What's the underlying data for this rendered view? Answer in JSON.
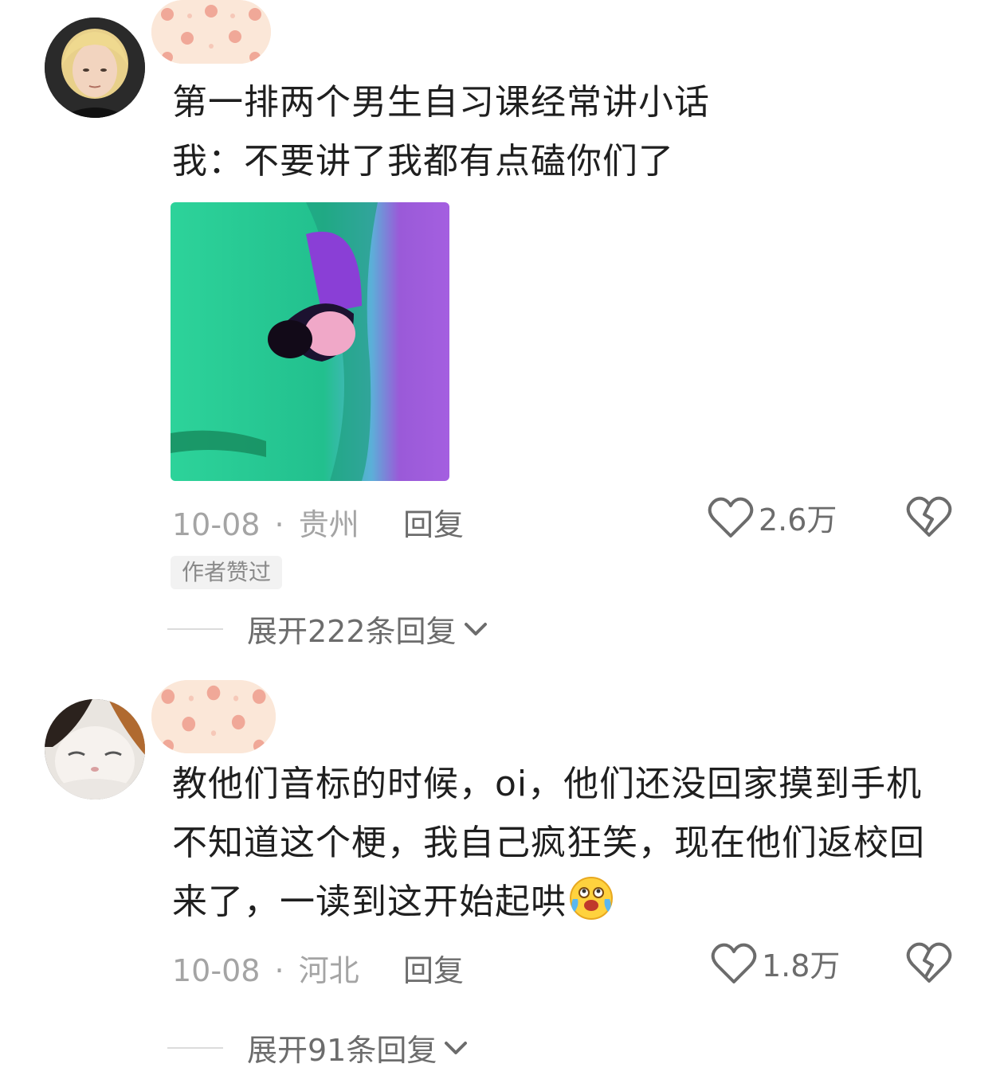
{
  "comments": [
    {
      "avatar_icon": "blonde-person-avatar",
      "badge_icon": "cat-pattern-badge",
      "lines": [
        "第一排两个男生自习课经常讲小话",
        "我：不要讲了我都有点磕你们了"
      ],
      "sticker_icon": "green-alien-eye-sticker",
      "date": "10-08",
      "location": "贵州",
      "reply_label": "回复",
      "likes": "2.6万",
      "author_liked_tag": "作者赞过",
      "expand_label": "展开222条回复"
    },
    {
      "avatar_icon": "calico-cat-avatar",
      "badge_icon": "cat-pattern-badge",
      "lines": [
        "教他们音标的时候，oi，他们还没回家摸到手机",
        "不知道这个梗，我自己疯狂笑，现在他们返校回",
        "来了，一读到这开始起哄"
      ],
      "trailing_emoji": "tearful-laugh-emoji",
      "date": "10-08",
      "location": "河北",
      "reply_label": "回复",
      "likes": "1.8万",
      "expand_label": "展开91条回复"
    }
  ],
  "separator": "·",
  "colors": {
    "text": "#1f1f1f",
    "meta": "#a4a4a4",
    "action": "#6c6c6c",
    "badge_bg": "#fbe7d8"
  }
}
